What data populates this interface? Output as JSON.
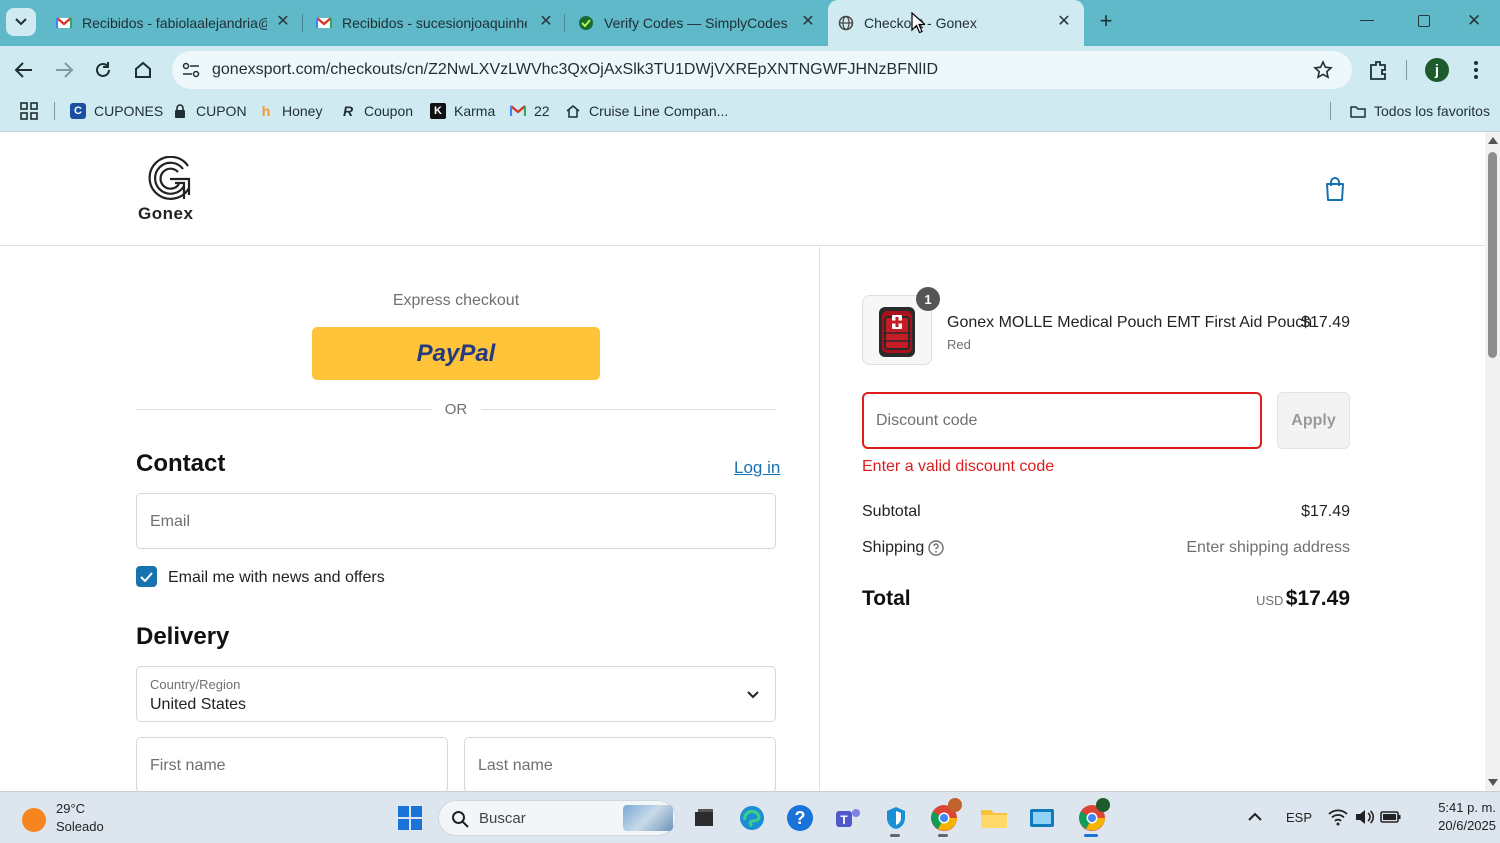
{
  "browser": {
    "tabs": [
      {
        "title": "Recibidos - fabiolaalejandria@g",
        "icon": "gmail-icon"
      },
      {
        "title": "Recibidos - sucesionjoaquinher",
        "icon": "gmail-icon"
      },
      {
        "title": "Verify Codes — SimplyCodes",
        "icon": "simplycodes-icon"
      },
      {
        "title": "Checkout - Gonex",
        "icon": "globe-icon"
      }
    ],
    "url": "gonexsport.com/checkouts/cn/Z2NwLXVzLWVhc3QxOjAxSlk3TU1DWjVXREpXNTNGWFJHNzBFNlID",
    "bookmarks": [
      {
        "label": "CUPONES",
        "icon": "coupons-icon"
      },
      {
        "label": "CUPON",
        "icon": "lock-icon"
      },
      {
        "label": "Honey",
        "icon": "honey-icon"
      },
      {
        "label": "Coupon",
        "icon": "coupon-icon"
      },
      {
        "label": "Karma",
        "icon": "karma-icon"
      },
      {
        "label": "22",
        "icon": "gmail-icon"
      },
      {
        "label": "Cruise Line Compan...",
        "icon": "house-icon"
      }
    ],
    "all_bookmarks": "Todos los favoritos",
    "profile_initial": "j"
  },
  "store": {
    "brand": "Gonex"
  },
  "checkout": {
    "express_checkout": "Express checkout",
    "paypal_label": "PayPal",
    "or_label": "OR",
    "contact_heading": "Contact",
    "login_link": "Log in",
    "email_placeholder": "Email",
    "newsletter_label": "Email me with news and offers",
    "newsletter_checked": true,
    "delivery_heading": "Delivery",
    "country_label": "Country/Region",
    "country_value": "United States",
    "first_name_placeholder": "First name",
    "last_name_placeholder": "Last name"
  },
  "summary": {
    "product_name": "Gonex MOLLE Medical Pouch EMT First Aid Pouch",
    "product_variant": "Red",
    "product_qty": "1",
    "product_price": "$17.49",
    "discount_placeholder": "Discount code",
    "apply_label": "Apply",
    "discount_error": "Enter a valid discount code",
    "subtotal_label": "Subtotal",
    "subtotal_value": "$17.49",
    "shipping_label": "Shipping",
    "shipping_value": "Enter shipping address",
    "total_label": "Total",
    "total_currency": "USD",
    "total_value": "$17.49"
  },
  "taskbar": {
    "weather_temp": "29°C",
    "weather_desc": "Soleado",
    "search_placeholder": "Buscar",
    "language": "ESP",
    "time": "5:41 p. m.",
    "date": "20/6/2025"
  },
  "colors": {
    "tabbar": "#5fb9c8",
    "toolbar": "#cfeaf0",
    "paypal_yellow": "#ffc439",
    "error_red": "#dd1d1d",
    "link_blue": "#1773b0"
  }
}
